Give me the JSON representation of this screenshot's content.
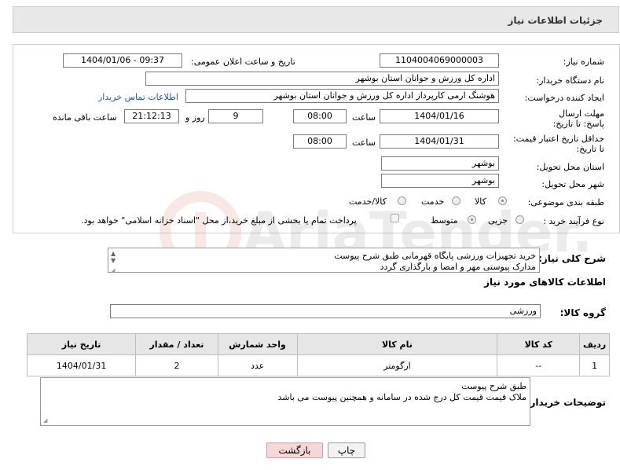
{
  "header": {
    "title": "جزئیات اطلاعات نیاز"
  },
  "fields": {
    "need_number_label": "شماره نیاز:",
    "need_number": "1104004069000003",
    "announce_label": "تاریخ و ساعت اعلان عمومی:",
    "announce_value": "1404/01/06 - 09:37",
    "buyer_org_label": "نام دستگاه خریدار:",
    "buyer_org": "اداره کل ورزش و جوانان استان بوشهر",
    "creator_label": "ایجاد کننده درخواست:",
    "creator": "هوشنگ ارمی کارپرداز اداره کل ورزش و جوانان استان بوشهر",
    "contact_link": "اطلاعات تماس خریدار",
    "deadline_label": "مهلت ارسال پاسخ: تا تاریخ:",
    "deadline_date": "1404/01/16",
    "time_label": "ساعت",
    "deadline_time": "08:00",
    "days_value": "9",
    "days_label": "روز و",
    "remaining_time": "21:12:13",
    "remaining_label": "ساعت باقی مانده",
    "validity_label": "حداقل تاریخ اعتبار قیمت: تا تاریخ:",
    "validity_date": "1404/01/31",
    "validity_time": "08:00",
    "province_label": "استان محل تحویل:",
    "province": "بوشهر",
    "city_label": "شهر محل تحویل:",
    "city": "بوشهر",
    "category_label": "طبقه بندی موضوعی:",
    "category_options": [
      "کالا",
      "خدمت",
      "کالا/خدمت"
    ],
    "process_label": "نوع فرآیند خرید :",
    "process_options": [
      "جزیی",
      "متوسط"
    ],
    "payment_note": "پرداخت تمام یا بخشی از مبلغ خرید،از محل \"اسناد خزانه اسلامی\" خواهد بود."
  },
  "description": {
    "label": "شرح کلی نیاز:",
    "line1": "خرید تجهیزات ورزشی پایگاه قهرمانی طبق شرح پیوست",
    "line2": "مدارک پیوستی مهر و امضا و بارگذاری گردد"
  },
  "goods_section": {
    "title": "اطلاعات کالاهای مورد نیاز",
    "group_label": "گروه کالا:",
    "group_value": "ورزشی"
  },
  "table": {
    "headers": [
      "ردیف",
      "کد کالا",
      "نام کالا",
      "واحد شمارش",
      "تعداد / مقدار",
      "تاریخ نیاز"
    ],
    "rows": [
      [
        "1",
        "--",
        "ارگومتر",
        "عدد",
        "2",
        "1404/01/31"
      ]
    ]
  },
  "buyer_notes": {
    "label": "توضیحات خریدار:",
    "line1": "طبق شرح پیوست",
    "line2": "ملاک قیمت قیمت کل درج شده در سامانه و همچنین پیوست می باشد"
  },
  "buttons": {
    "print": "چاپ",
    "back": "بازگشت"
  },
  "watermark": {
    "text": "AriaTender.neT"
  },
  "colors": {
    "link": "#1a55c0",
    "back_button_bg": "#f7d7d7",
    "watermark": "#c0392b"
  }
}
